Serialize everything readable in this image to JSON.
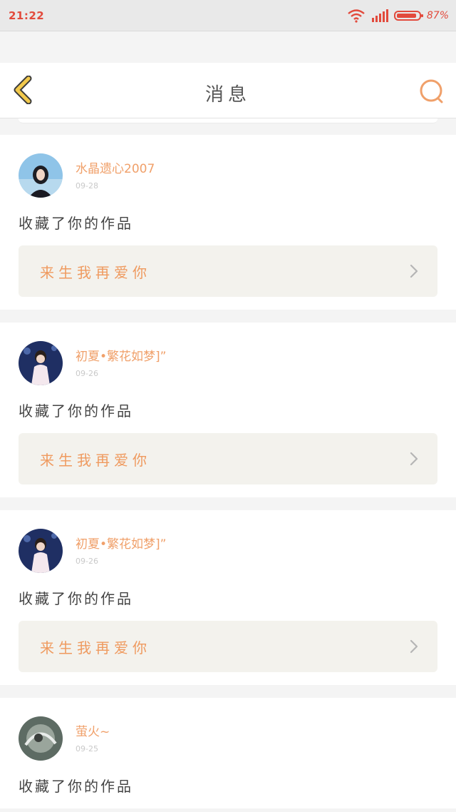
{
  "status": {
    "time": "21:22",
    "battery": "87%"
  },
  "nav": {
    "title": "消息"
  },
  "items": [
    {
      "user": "水晶遗心2007",
      "date": "09-28",
      "action": "收藏了你的作品",
      "work": "来生我再爱你"
    },
    {
      "user": "初夏•繁花如梦]”",
      "date": "09-26",
      "action": "收藏了你的作品",
      "work": "来生我再爱你"
    },
    {
      "user": "初夏•繁花如梦]”",
      "date": "09-26",
      "action": "收藏了你的作品",
      "work": "来生我再爱你"
    },
    {
      "user": "萤火~",
      "date": "09-25",
      "action": "收藏了你的作品",
      "work": ""
    }
  ],
  "colors": {
    "accent": "#f0a06a",
    "back_icon": "#f2c94c",
    "status_red": "#e24a3c"
  },
  "icons": {
    "back": "back-chevron-icon",
    "search": "search-icon",
    "more": "chevron-right-icon"
  }
}
